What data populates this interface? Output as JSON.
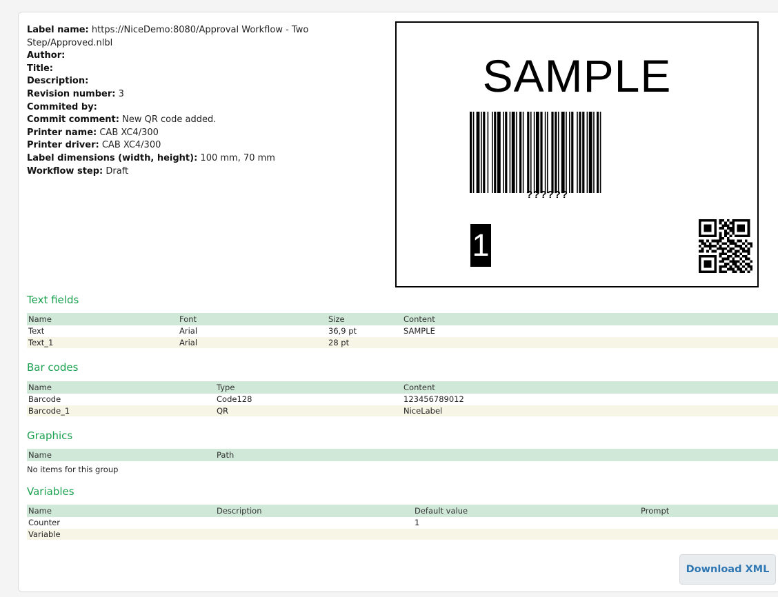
{
  "meta": {
    "label_name_key": "Label name:",
    "label_name_value": "https://NiceDemo:8080/Approval Workflow - Two Step/Approved.nlbl",
    "author_key": "Author:",
    "author_value": "",
    "title_key": "Title:",
    "title_value": "",
    "description_key": "Description:",
    "description_value": "",
    "revision_key": "Revision number:",
    "revision_value": "3",
    "commited_by_key": "Commited by:",
    "commited_by_value": "",
    "commit_comment_key": "Commit comment:",
    "commit_comment_value": "New QR code added.",
    "printer_name_key": "Printer name:",
    "printer_name_value": "CAB XC4/300",
    "printer_driver_key": "Printer driver:",
    "printer_driver_value": "CAB XC4/300",
    "dimensions_key": "Label dimensions (width, height):",
    "dimensions_value": "100 mm, 70 mm",
    "workflow_key": "Workflow step:",
    "workflow_value": "Draft"
  },
  "preview": {
    "sample_text": "SAMPLE",
    "barcode_text": "??????",
    "counter_text": "1"
  },
  "text_fields": {
    "title": "Text fields",
    "headers": [
      "Name",
      "Font",
      "Size",
      "Content"
    ],
    "rows": [
      [
        "Text",
        "Arial",
        "36,9 pt",
        "SAMPLE"
      ],
      [
        "Text_1",
        "Arial",
        "28 pt",
        ""
      ]
    ]
  },
  "bar_codes": {
    "title": "Bar codes",
    "headers": [
      "Name",
      "Type",
      "Content"
    ],
    "rows": [
      [
        "Barcode",
        "Code128",
        "123456789012"
      ],
      [
        "Barcode_1",
        "QR",
        "NiceLabel"
      ]
    ]
  },
  "graphics": {
    "title": "Graphics",
    "headers": [
      "Name",
      "Path"
    ],
    "empty_text": "No items for this group"
  },
  "variables": {
    "title": "Variables",
    "headers": [
      "Name",
      "Description",
      "Default value",
      "Prompt"
    ],
    "rows": [
      [
        "Counter",
        "",
        "1",
        ""
      ],
      [
        "Variable",
        "",
        "",
        ""
      ]
    ]
  },
  "download_button": "Download XML"
}
